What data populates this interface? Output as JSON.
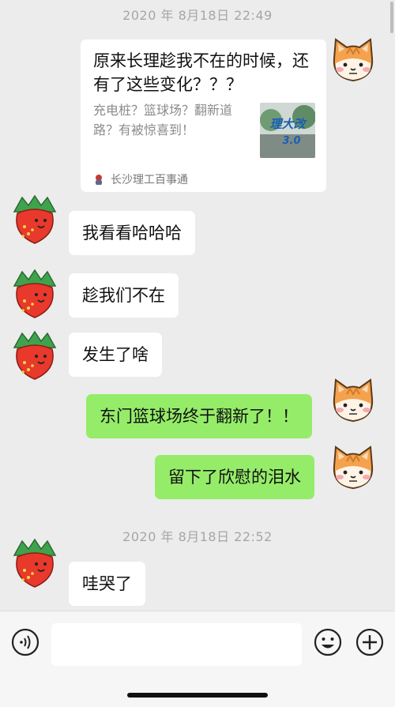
{
  "chat": {
    "timestamps": [
      "2020 年 8月18日 22:49",
      "2020 年 8月18日 22:52"
    ],
    "link_card": {
      "title": "原来长理趁我不在的时候，还有了这些变化？？？",
      "description": "充电桩？篮球场？翻新道路？有被惊喜到！",
      "thumbnail_text": "理大改 3.0",
      "source": "长沙理工百事通"
    },
    "messages": [
      {
        "side": "left",
        "text": "我看看哈哈哈"
      },
      {
        "side": "left",
        "text": "趁我们不在"
      },
      {
        "side": "left",
        "text": "发生了啥"
      },
      {
        "side": "right",
        "text": "东门篮球场终于翻新了！！"
      },
      {
        "side": "right",
        "text": "留下了欣慰的泪水"
      },
      {
        "side": "left",
        "text": "哇哭了"
      }
    ]
  },
  "avatars": {
    "self": "cat-avatar",
    "other": "strawberry-avatar"
  },
  "input_bar": {
    "value": "",
    "icons": [
      "voice-icon",
      "emoji-icon",
      "plus-icon"
    ]
  },
  "colors": {
    "background": "#ececec",
    "bubble_left": "#ffffff",
    "bubble_right": "#95ec69",
    "timestamp": "#a6a6a6"
  }
}
